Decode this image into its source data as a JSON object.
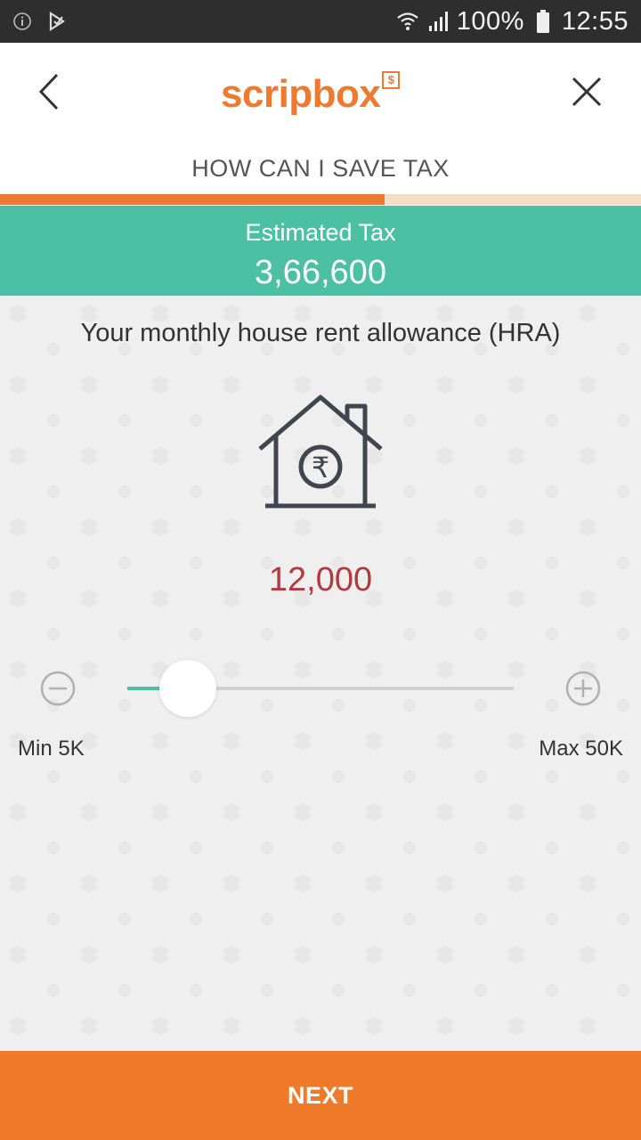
{
  "status_bar": {
    "battery": "100%",
    "time": "12:55",
    "icons": [
      "info-icon",
      "app-notification-icon",
      "wifi-icon",
      "signal-icon",
      "battery-icon"
    ]
  },
  "header": {
    "logo_text": "scripbox",
    "logo_badge": "$",
    "subtitle": "HOW CAN I SAVE TAX",
    "back_icon": "chevron-left-icon",
    "close_icon": "close-icon"
  },
  "progress": {
    "fraction": 0.6
  },
  "estimate": {
    "label": "Estimated Tax",
    "value": "3,66,600"
  },
  "question": {
    "text": "Your monthly house rent allowance (HRA)",
    "icon": "house-rupee-icon",
    "amount": "12,000"
  },
  "slider": {
    "min_label": "Min 5K",
    "max_label": "Max 50K",
    "min": 5000,
    "max": 50000,
    "value": 12000
  },
  "footer": {
    "next_label": "NEXT"
  },
  "colors": {
    "brand_orange": "#ee7a2f",
    "teal": "#4cc0a3",
    "amount_red": "#b3393f"
  }
}
